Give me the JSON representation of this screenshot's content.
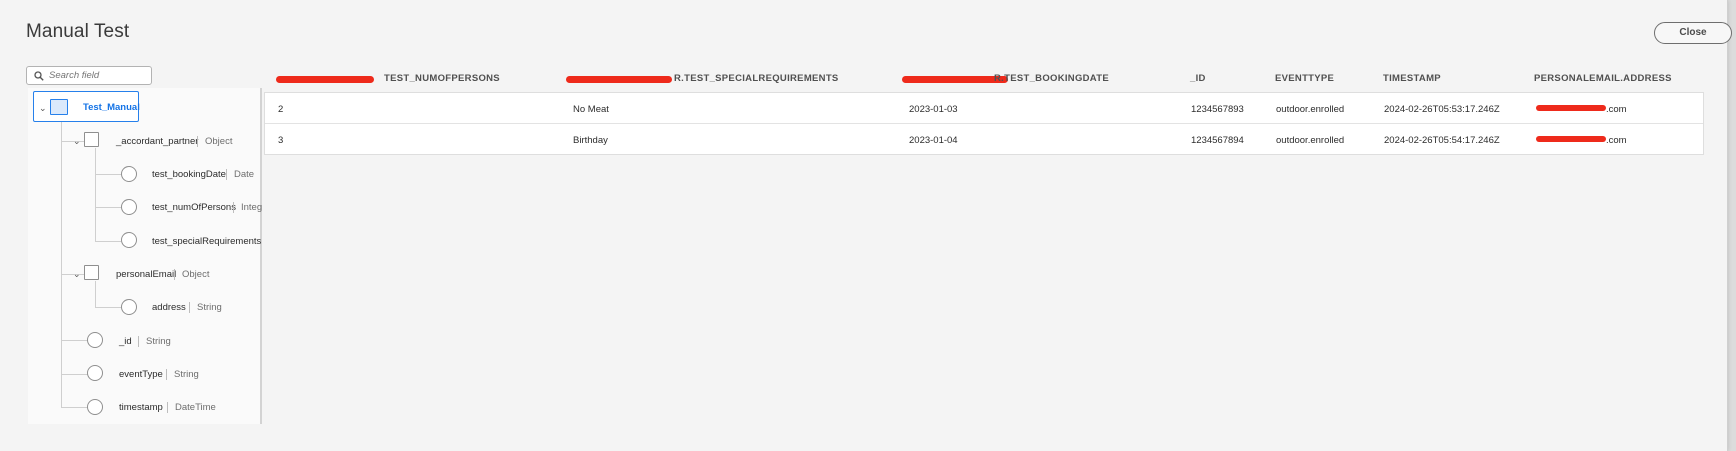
{
  "dialog": {
    "title": "Manual Test",
    "close_label": "Close"
  },
  "search": {
    "placeholder": "Search field",
    "icon": "search-icon"
  },
  "schema_tree": {
    "root": {
      "name": "Test_Manual"
    },
    "fields": [
      {
        "name": "_accordant_partner",
        "type": "Object"
      },
      {
        "name": "test_bookingDate",
        "type": "Date"
      },
      {
        "name": "test_numOfPersons",
        "type": "Integ"
      },
      {
        "name": "test_specialRequirements",
        "type": ""
      },
      {
        "name": "personalEmail",
        "type": "Object"
      },
      {
        "name": "address",
        "type": "String"
      },
      {
        "name": "_id",
        "type": "String"
      },
      {
        "name": "eventType",
        "type": "String"
      },
      {
        "name": "timestamp",
        "type": "DateTime"
      }
    ]
  },
  "table": {
    "columns": [
      "TEST_NUMOFPERSONS",
      "R.TEST_SPECIALREQUIREMENTS",
      "R.TEST_BOOKINGDATE",
      "_ID",
      "EVENTTYPE",
      "TIMESTAMP",
      "PERSONALEMAIL.ADDRESS"
    ],
    "rows": [
      {
        "num_persons": "2",
        "special_requirements": "No Meat",
        "booking_date": "2023-01-03",
        "id": "1234567893",
        "event_type": "outdoor.enrolled",
        "timestamp": "2024-02-26T05:53:17.246Z",
        "email_suffix": ".com"
      },
      {
        "num_persons": "3",
        "special_requirements": "Birthday",
        "booking_date": "2023-01-04",
        "id": "1234567894",
        "event_type": "outdoor.enrolled",
        "timestamp": "2024-02-26T05:54:17.246Z",
        "email_suffix": ".com"
      }
    ]
  },
  "colors": {
    "accent": "#2680eb",
    "redaction": "#ee2a1b"
  }
}
